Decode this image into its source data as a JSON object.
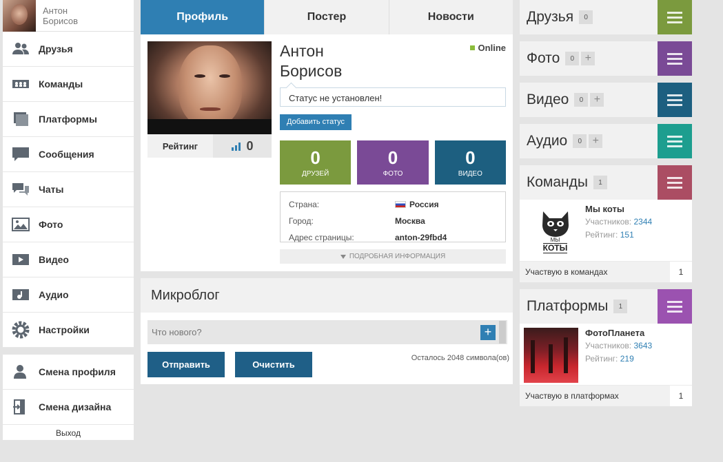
{
  "sidebar": {
    "user_first": "Антон",
    "user_last": "Борисов",
    "items": [
      {
        "label": "Друзья",
        "icon": "friends-icon"
      },
      {
        "label": "Команды",
        "icon": "teams-icon"
      },
      {
        "label": "Платформы",
        "icon": "platforms-icon"
      },
      {
        "label": "Сообщения",
        "icon": "messages-icon"
      },
      {
        "label": "Чаты",
        "icon": "chats-icon"
      },
      {
        "label": "Фото",
        "icon": "photo-icon"
      },
      {
        "label": "Видео",
        "icon": "video-icon"
      },
      {
        "label": "Аудио",
        "icon": "audio-icon"
      },
      {
        "label": "Настройки",
        "icon": "gear-icon"
      }
    ],
    "items2": [
      {
        "label": "Смена профиля",
        "icon": "profile-switch-icon"
      },
      {
        "label": "Смена дизайна",
        "icon": "design-switch-icon"
      }
    ],
    "logout": "Выход"
  },
  "tabs": [
    "Профиль",
    "Постер",
    "Новости"
  ],
  "profile": {
    "name_first": "Антон",
    "name_last": "Борисов",
    "online": "Online",
    "status": "Статус не установлен!",
    "add_status": "Добавить статус",
    "rating_label": "Рейтинг",
    "rating_value": "0",
    "stats": [
      {
        "value": "0",
        "label": "ДРУЗЕЙ",
        "color": "#7b9a3e"
      },
      {
        "value": "0",
        "label": "ФОТО",
        "color": "#7a4a96"
      },
      {
        "value": "0",
        "label": "ВИДЕО",
        "color": "#1d5f80"
      }
    ],
    "info": [
      {
        "key": "Страна:",
        "value": "Россия"
      },
      {
        "key": "Город:",
        "value": "Москва"
      },
      {
        "key": "Адрес страницы:",
        "value": "anton-29fbd4"
      }
    ],
    "more": "ПОДРОБНАЯ ИНФОРМАЦИЯ"
  },
  "microblog": {
    "title": "Микроблог",
    "placeholder": "Что нового?",
    "send": "Отправить",
    "clear": "Очистить",
    "remaining": "Осталось 2048 символа(ов)"
  },
  "right": {
    "friends": {
      "title": "Друзья",
      "count": "0",
      "color": "#7b9a3e"
    },
    "photo": {
      "title": "Фото",
      "count": "0",
      "color": "#7a4a96"
    },
    "video": {
      "title": "Видео",
      "count": "0",
      "color": "#1d5f80"
    },
    "audio": {
      "title": "Аудио",
      "count": "0",
      "color": "#1d9e8f"
    },
    "teams": {
      "title": "Команды",
      "count": "1",
      "color": "#ab4d63",
      "item_name": "Мы коты",
      "members_label": "Участников:",
      "members": "2344",
      "rating_label": "Рейтинг:",
      "rating": "151",
      "logo_top": "МЫ",
      "logo_bottom": "КОТЫ",
      "footer": "Участвую в командах",
      "footer_count": "1"
    },
    "platforms": {
      "title": "Платформы",
      "count": "1",
      "color": "#9b52b0",
      "item_name": "ФотоПланета",
      "members_label": "Участников:",
      "members": "3643",
      "rating_label": "Рейтинг:",
      "rating": "219",
      "footer": "Участвую в платформах",
      "footer_count": "1"
    },
    "plus": "+"
  },
  "colors": {
    "accent": "#2f7fb3",
    "online": "#8bbc3b"
  }
}
